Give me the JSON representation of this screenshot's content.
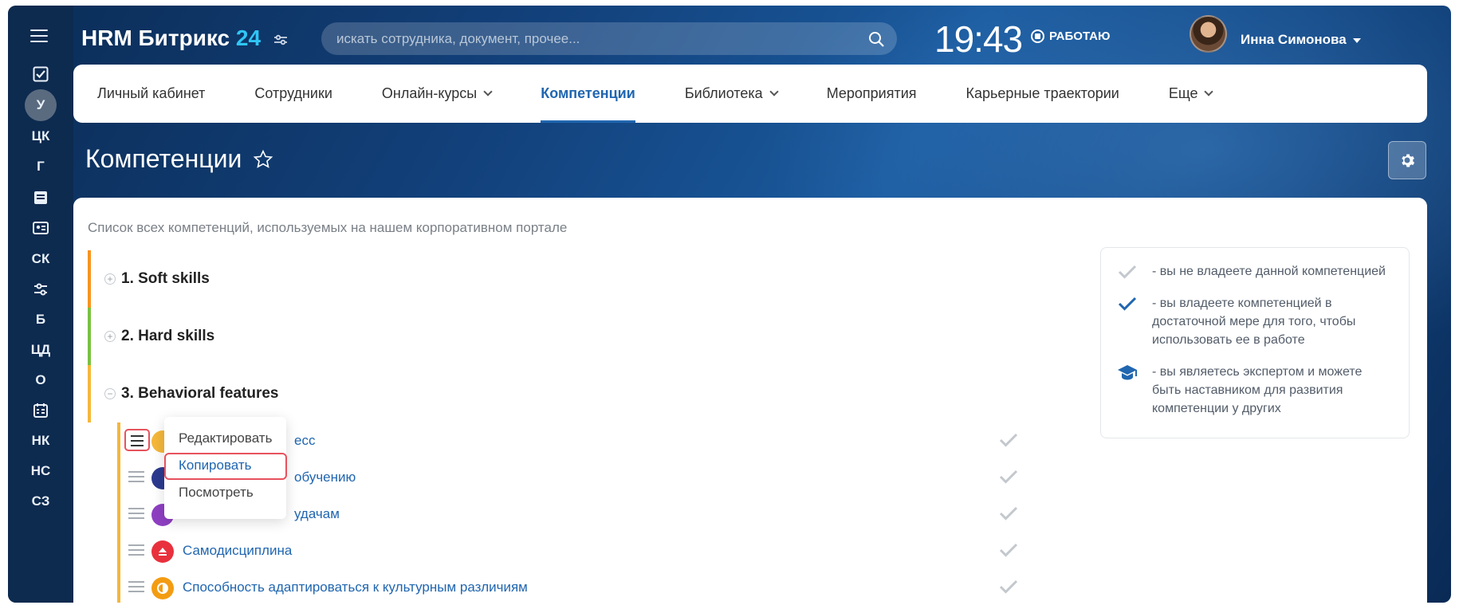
{
  "header": {
    "app_name": "HRM Битрикс",
    "app_version": "24",
    "search_placeholder": "искать сотрудника, документ, прочее...",
    "time": "19:43",
    "status": "РАБОТАЮ",
    "user_name": "Инна Симонова"
  },
  "rail": {
    "items": [
      "У",
      "ЦК",
      "Г",
      "Б",
      "ЦД",
      "О",
      "НК",
      "НС",
      "СЗ",
      "СК"
    ]
  },
  "nav": {
    "items": [
      {
        "label": "Личный кабинет"
      },
      {
        "label": "Сотрудники"
      },
      {
        "label": "Онлайн-курсы"
      },
      {
        "label": "Компетенции"
      },
      {
        "label": "Библиотека"
      },
      {
        "label": "Мероприятия"
      },
      {
        "label": "Карьерные траектории"
      },
      {
        "label": "Еще"
      }
    ],
    "active": "Компетенции"
  },
  "page": {
    "title": "Компетенции",
    "description": "Список всех компетенций, используемых на нашем корпоративном портале"
  },
  "groups": [
    {
      "title": "1. Soft skills",
      "color": "#f7931e",
      "toggle": "+"
    },
    {
      "title": "2. Hard skills",
      "color": "#7ac142",
      "toggle": "+"
    },
    {
      "title": "3. Behavioral features",
      "color": "#f5b73a",
      "toggle": "−"
    }
  ],
  "competencies": [
    {
      "label": "есс",
      "icon_color": "#f5b73a"
    },
    {
      "label": "обучению",
      "icon_color": "#2b3a8f"
    },
    {
      "label": "удачам",
      "icon_color": "#8e3fc2"
    },
    {
      "label": "Самодисциплина",
      "icon_color": "#e8313d"
    },
    {
      "label": "Способность адаптироваться к культурным различиям",
      "icon_color": "#f39c12"
    }
  ],
  "context_menu": {
    "items": [
      "Редактировать",
      "Копировать",
      "Посмотреть"
    ]
  },
  "legend": {
    "items": [
      "- вы не владеете данной компетенцией",
      "- вы владеете компетенцией в достаточной мере для того, чтобы использовать ее в работе",
      "- вы являетесь экспертом и можете быть наставником для развития компетенции у других"
    ]
  },
  "colors": {
    "accent": "#2066b0",
    "highlight": "#e7525d",
    "check_gray": "#c3c8cd",
    "check_blue": "#2066b0"
  }
}
